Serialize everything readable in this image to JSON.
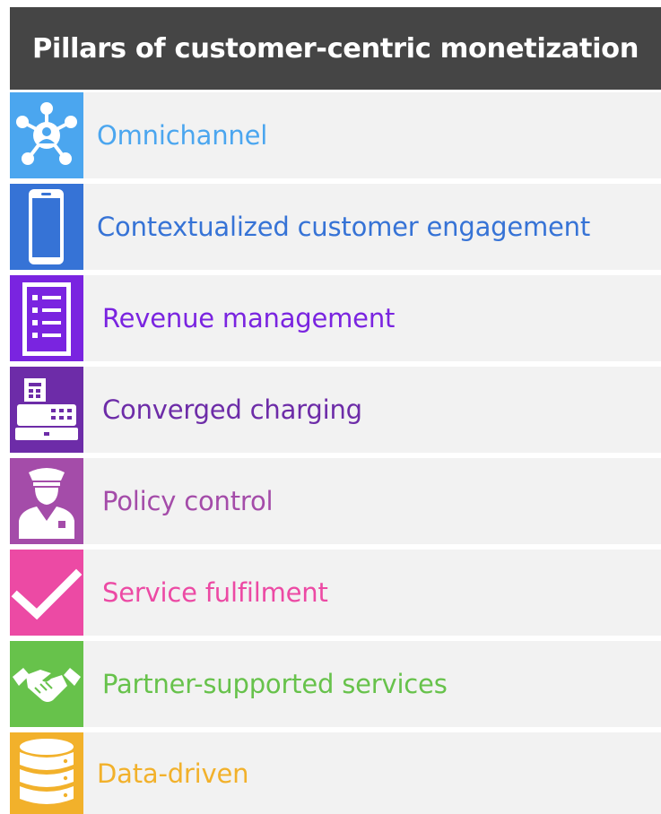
{
  "title": "Pillars of customer-centric monetization",
  "pillars": [
    {
      "label": "Omnichannel",
      "icon": "network-hub-icon",
      "color": "#4ba6ef"
    },
    {
      "label": "Contextualized customer engagement",
      "icon": "smartphone-icon",
      "color": "#3673d6"
    },
    {
      "label": "Revenue management",
      "icon": "checklist-icon",
      "color": "#7a24e0"
    },
    {
      "label": "Converged charging",
      "icon": "cash-register-icon",
      "color": "#6d2ca8"
    },
    {
      "label": "Policy control",
      "icon": "police-officer-icon",
      "color": "#a44ca9"
    },
    {
      "label": "Service fulfilment",
      "icon": "checkmark-icon",
      "color": "#ec4aa4"
    },
    {
      "label": "Partner-supported services",
      "icon": "handshake-icon",
      "color": "#67c24b"
    },
    {
      "label": "Data-driven",
      "icon": "database-icon",
      "color": "#f2b12b"
    }
  ]
}
